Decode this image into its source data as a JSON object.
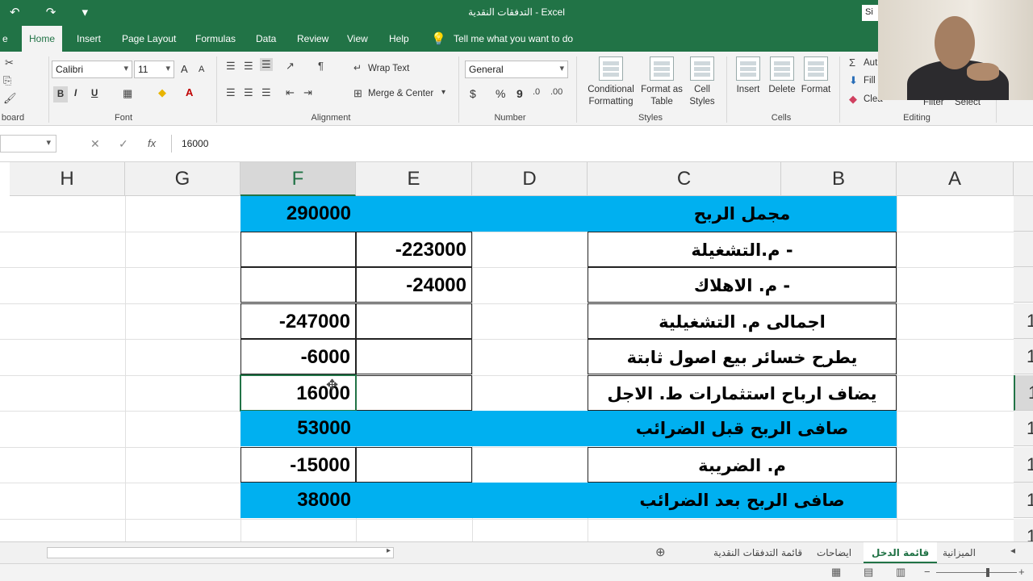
{
  "window": {
    "title": "التدفقات النقدية  -  Excel",
    "signin_label": "Si",
    "quick_access": [
      "undo-icon",
      "redo-icon",
      "customize-icon"
    ]
  },
  "ribbon_tabs": [
    "Home",
    "Insert",
    "Page Layout",
    "Formulas",
    "Data",
    "Review",
    "View",
    "Help"
  ],
  "ribbon_tab_partial": "e",
  "tell_me": "Tell me what you want to do",
  "ribbon": {
    "clipboard_label": "board",
    "font": {
      "name": "Calibri",
      "size": "11",
      "label": "Font",
      "bold": "B",
      "italic": "I",
      "underline": "U",
      "grow": "A",
      "shrink": "A"
    },
    "alignment": {
      "wrap_text": "Wrap Text",
      "merge_center": "Merge & Center",
      "label": "Alignment"
    },
    "number": {
      "format": "General",
      "currency": "$",
      "percent": "%",
      "comma": "9",
      "label": "Number"
    },
    "styles": {
      "conditional": "Conditional\nFormatting",
      "format_table": "Format as\nTable",
      "cell_styles": "Cell\nStyles",
      "label": "Styles"
    },
    "cells": {
      "insert": "Insert",
      "delete": "Delete",
      "format": "Format",
      "label": "Cells"
    },
    "editing": {
      "autosum": "Aut",
      "fill": "Fill",
      "clear": "Clea",
      "filter": "Filter",
      "select": "Select",
      "label": "Editing"
    }
  },
  "formula_bar": {
    "fx": "fx",
    "value": "16000"
  },
  "columns": [
    "H",
    "G",
    "F",
    "E",
    "D",
    "C",
    "B",
    "A"
  ],
  "selected_column": "F",
  "row_headers": [
    "",
    "",
    "",
    "1",
    "1",
    "1",
    "1",
    "1",
    "1",
    "1"
  ],
  "rows": [
    {
      "label": "مجمل الربح",
      "e": "",
      "f": "290000",
      "highlight": true
    },
    {
      "label": "- م.التشغيلة",
      "e": "-223000",
      "f": "",
      "highlight": false
    },
    {
      "label": "- م. الاهلاك",
      "e": "-24000",
      "f": "",
      "highlight": false
    },
    {
      "label": "اجمالى م. التشغيلية",
      "e": "",
      "f": "-247000",
      "highlight": false
    },
    {
      "label": "يطرح خسائر بيع اصول ثابتة",
      "e": "",
      "f": "-6000",
      "highlight": false
    },
    {
      "label": "يضاف ارباح استثمارات ط. الاجل",
      "e": "",
      "f": "16000",
      "highlight": false
    },
    {
      "label": "صافى الربح قبل الضرائب",
      "e": "",
      "f": "53000",
      "highlight": true
    },
    {
      "label": "م. الضريبة",
      "e": "",
      "f": "-15000",
      "highlight": false
    },
    {
      "label": "صافى الربح بعد الضرائب",
      "e": "",
      "f": "38000",
      "highlight": true
    }
  ],
  "sheet_tabs": [
    "الميزانية",
    "قائمة الدخل",
    "ايضاحات",
    "قائمة التدفقات النقدية"
  ],
  "active_sheet": "قائمة الدخل",
  "colors": {
    "excel_green": "#217346",
    "highlight": "#00b0f0"
  }
}
